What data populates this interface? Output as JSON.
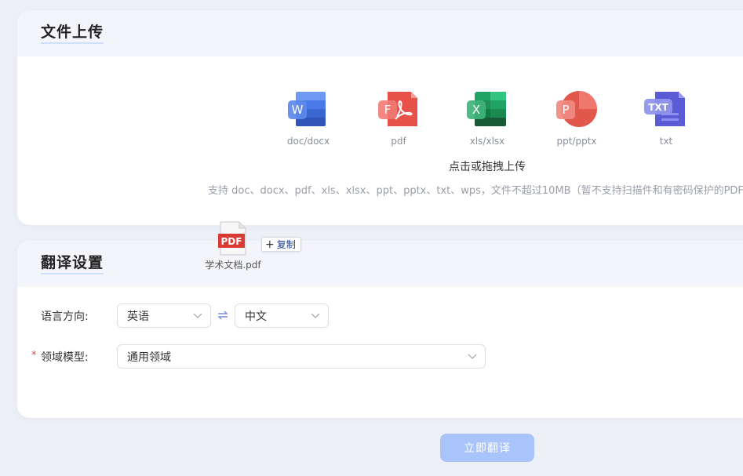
{
  "upload": {
    "title": "文件上传",
    "file_types": [
      {
        "label": "doc/docx",
        "icon": "word-icon",
        "color": "#3f6fe0"
      },
      {
        "label": "pdf",
        "icon": "pdf-icon",
        "color": "#e8514a"
      },
      {
        "label": "xls/xlsx",
        "icon": "excel-icon",
        "color": "#2e8b57"
      },
      {
        "label": "ppt/pptx",
        "icon": "powerpoint-icon",
        "color": "#e2574c"
      },
      {
        "label": "txt",
        "icon": "txt-icon",
        "color": "#5b5bd6"
      }
    ],
    "hint": "点击或拖拽上传",
    "description": "支持 doc、docx、pdf、xls、xlsx、ppt、pptx、txt、wps，文件不超过10MB（暂不支持扫描件和有密码保护的PDF）"
  },
  "drag": {
    "file_name": "学术文档.pdf",
    "icon_text": "PDF",
    "copy_label": "复制"
  },
  "settings": {
    "title": "翻译设置",
    "language_label": "语言方向:",
    "source_language": "英语",
    "target_language": "中文",
    "domain_label": "领域模型:",
    "domain_value": "通用领域",
    "required_mark": "*"
  },
  "actions": {
    "translate_label": "立即翻译"
  },
  "colors": {
    "primary_disabled": "#a9c4fb",
    "title_underline": "#cfe0fb"
  }
}
